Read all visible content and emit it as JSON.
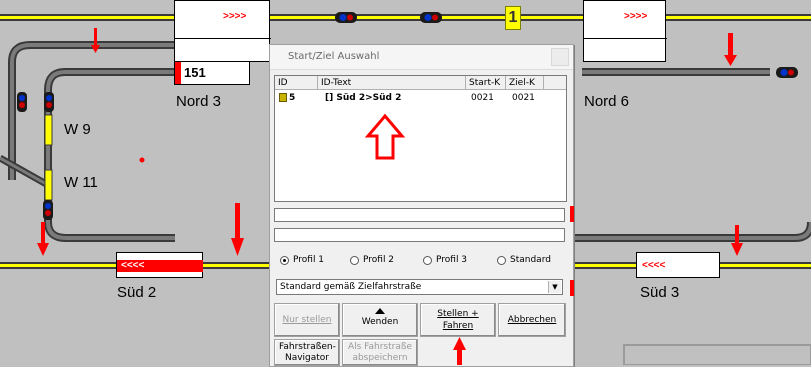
{
  "layout_labels": {
    "block_nord3_number": "151",
    "nord3": "Nord 3",
    "nord6": "Nord 6",
    "w9": "W 9",
    "w11": "W 11",
    "sued2": "Süd 2",
    "sued3": "Süd 3",
    "track_number": "1",
    "arrows_right_1": ">>>>",
    "arrows_right_2": ">>>>",
    "arrows_left_1": "<<<<",
    "arrows_left_2": "<<<<"
  },
  "dialog": {
    "title": "Start/Ziel Auswahl",
    "columns": [
      "ID",
      "ID-Text",
      "Start-K",
      "Ziel-K"
    ],
    "rows": [
      {
        "id": "5",
        "text": "[] Süd 2>Süd 2",
        "start": "0021",
        "ziel": "0021"
      }
    ],
    "profiles": [
      "Profil 1",
      "Profil 2",
      "Profil 3",
      "Standard"
    ],
    "selected_profile": "Profil 1",
    "select_value": "Standard gemäß Zielfahrstraße",
    "buttons": {
      "nur_stellen": "Nur stellen",
      "wenden": "Wenden",
      "stellen_fahren": "Stellen + Fahren",
      "abbrechen": "Abbrechen",
      "navigator": "Fahrstraßen-Navigator",
      "speichern": "Als Fahrstraße abspeichern"
    }
  },
  "colors": {
    "background": "#c0c0c0",
    "track": "#4a4a4a",
    "track_highlight": "#ffff00",
    "arrow": "#ff0000",
    "annotation": "#ff0000"
  }
}
